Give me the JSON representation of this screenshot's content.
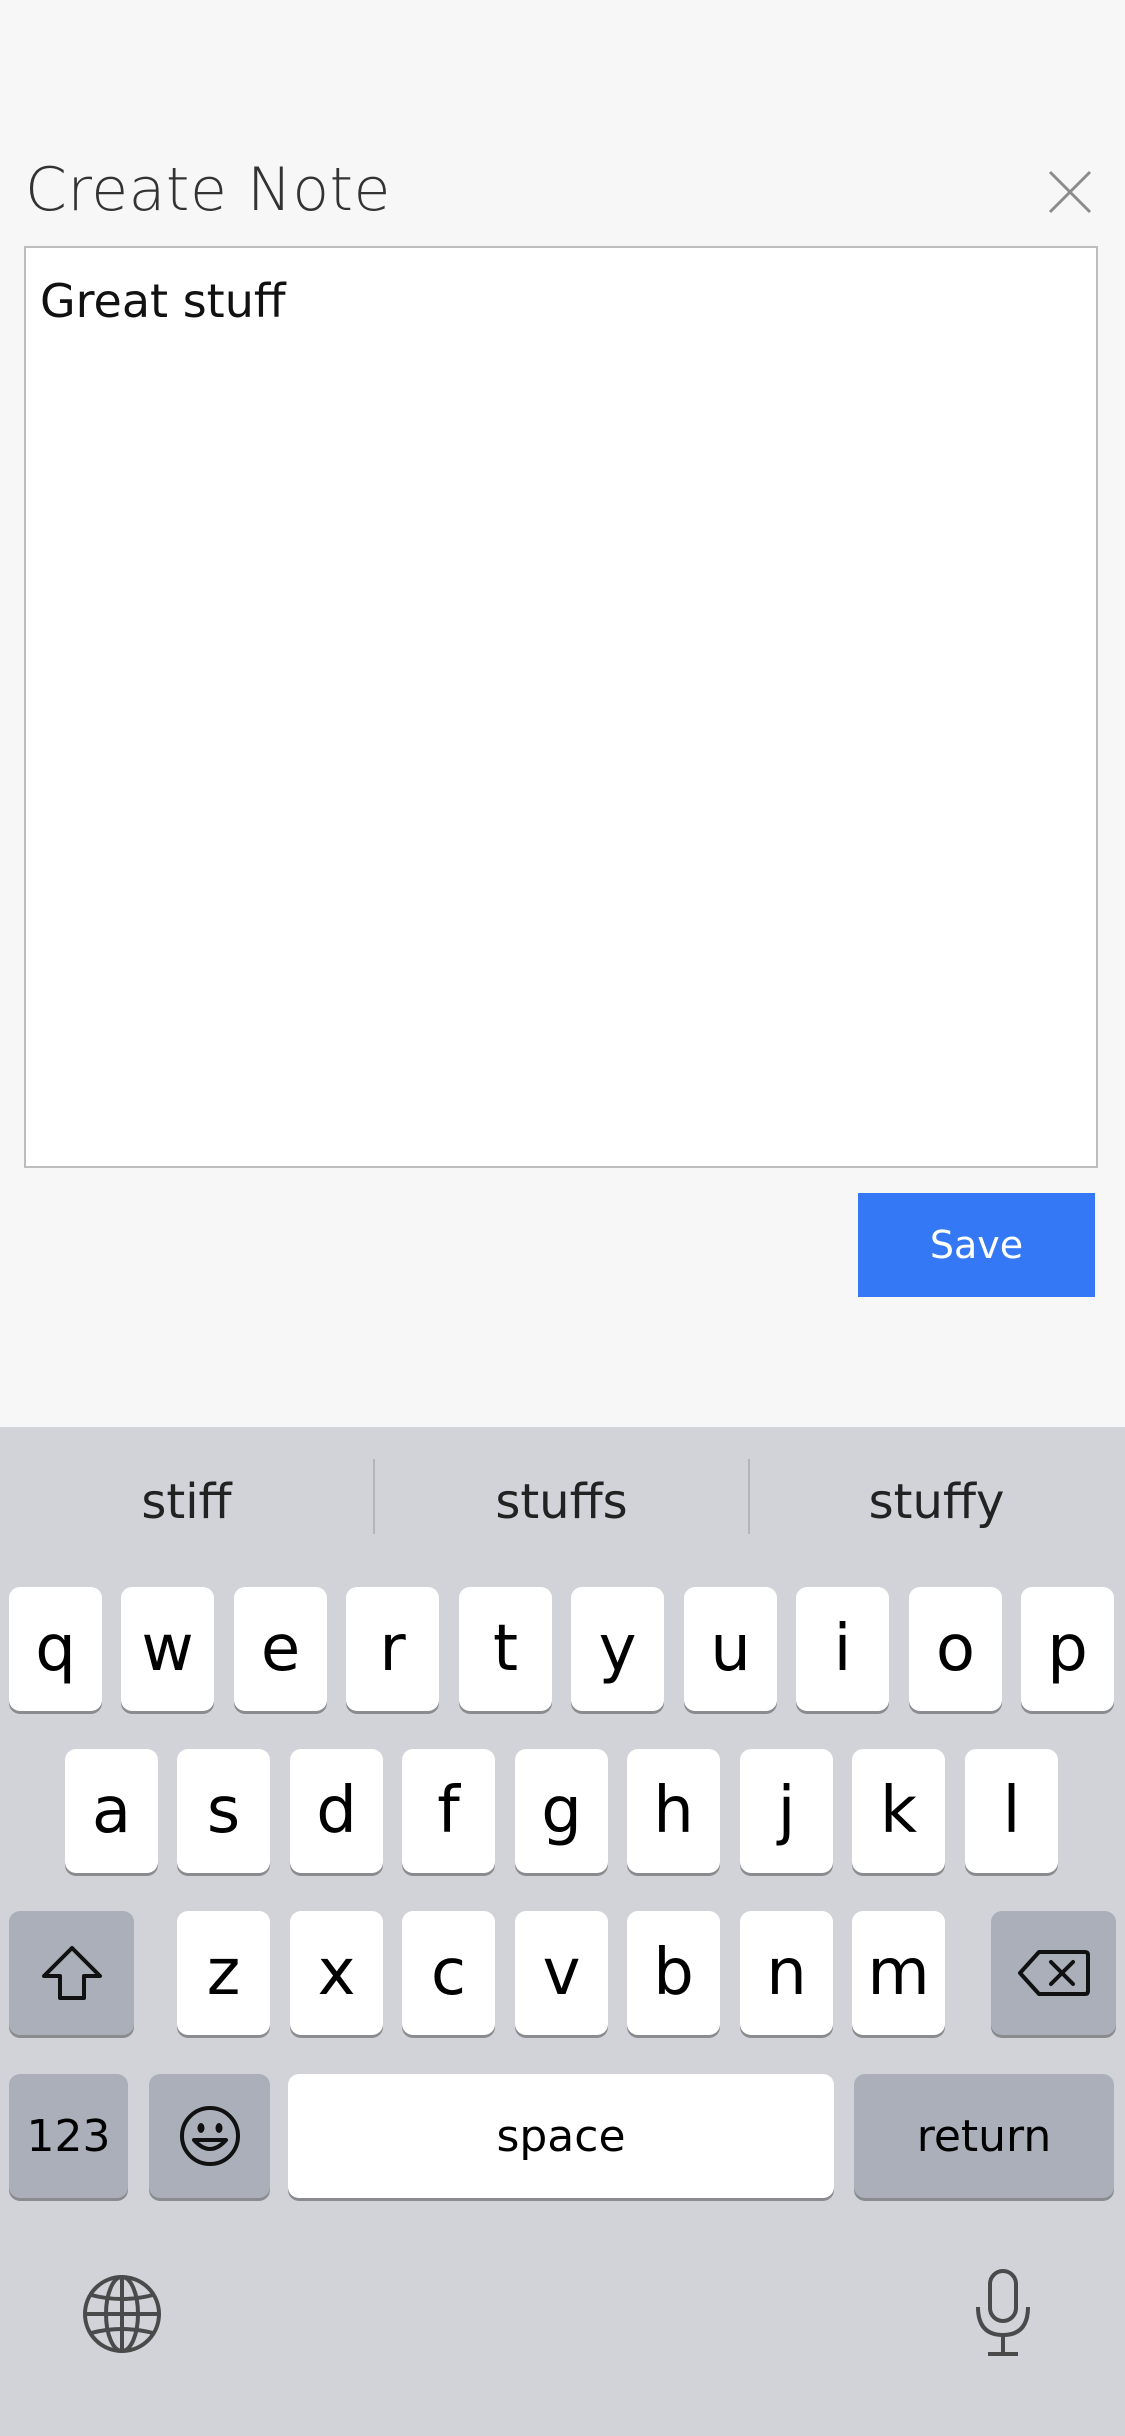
{
  "header": {
    "title": "Create Note",
    "close_icon": "close-icon"
  },
  "note": {
    "text": "Great stuff"
  },
  "actions": {
    "save_label": "Save",
    "save_color": "#3478f6"
  },
  "keyboard": {
    "suggestions": [
      "stiff",
      "stuffs",
      "stuffy"
    ],
    "row1": [
      "q",
      "w",
      "e",
      "r",
      "t",
      "y",
      "u",
      "i",
      "o",
      "p"
    ],
    "row2": [
      "a",
      "s",
      "d",
      "f",
      "g",
      "h",
      "j",
      "k",
      "l"
    ],
    "row3": [
      "z",
      "x",
      "c",
      "v",
      "b",
      "n",
      "m"
    ],
    "numbers_label": "123",
    "space_label": "space",
    "return_label": "return",
    "icons": [
      "shift-icon",
      "backspace-icon",
      "emoji-icon",
      "globe-icon",
      "microphone-icon"
    ]
  }
}
